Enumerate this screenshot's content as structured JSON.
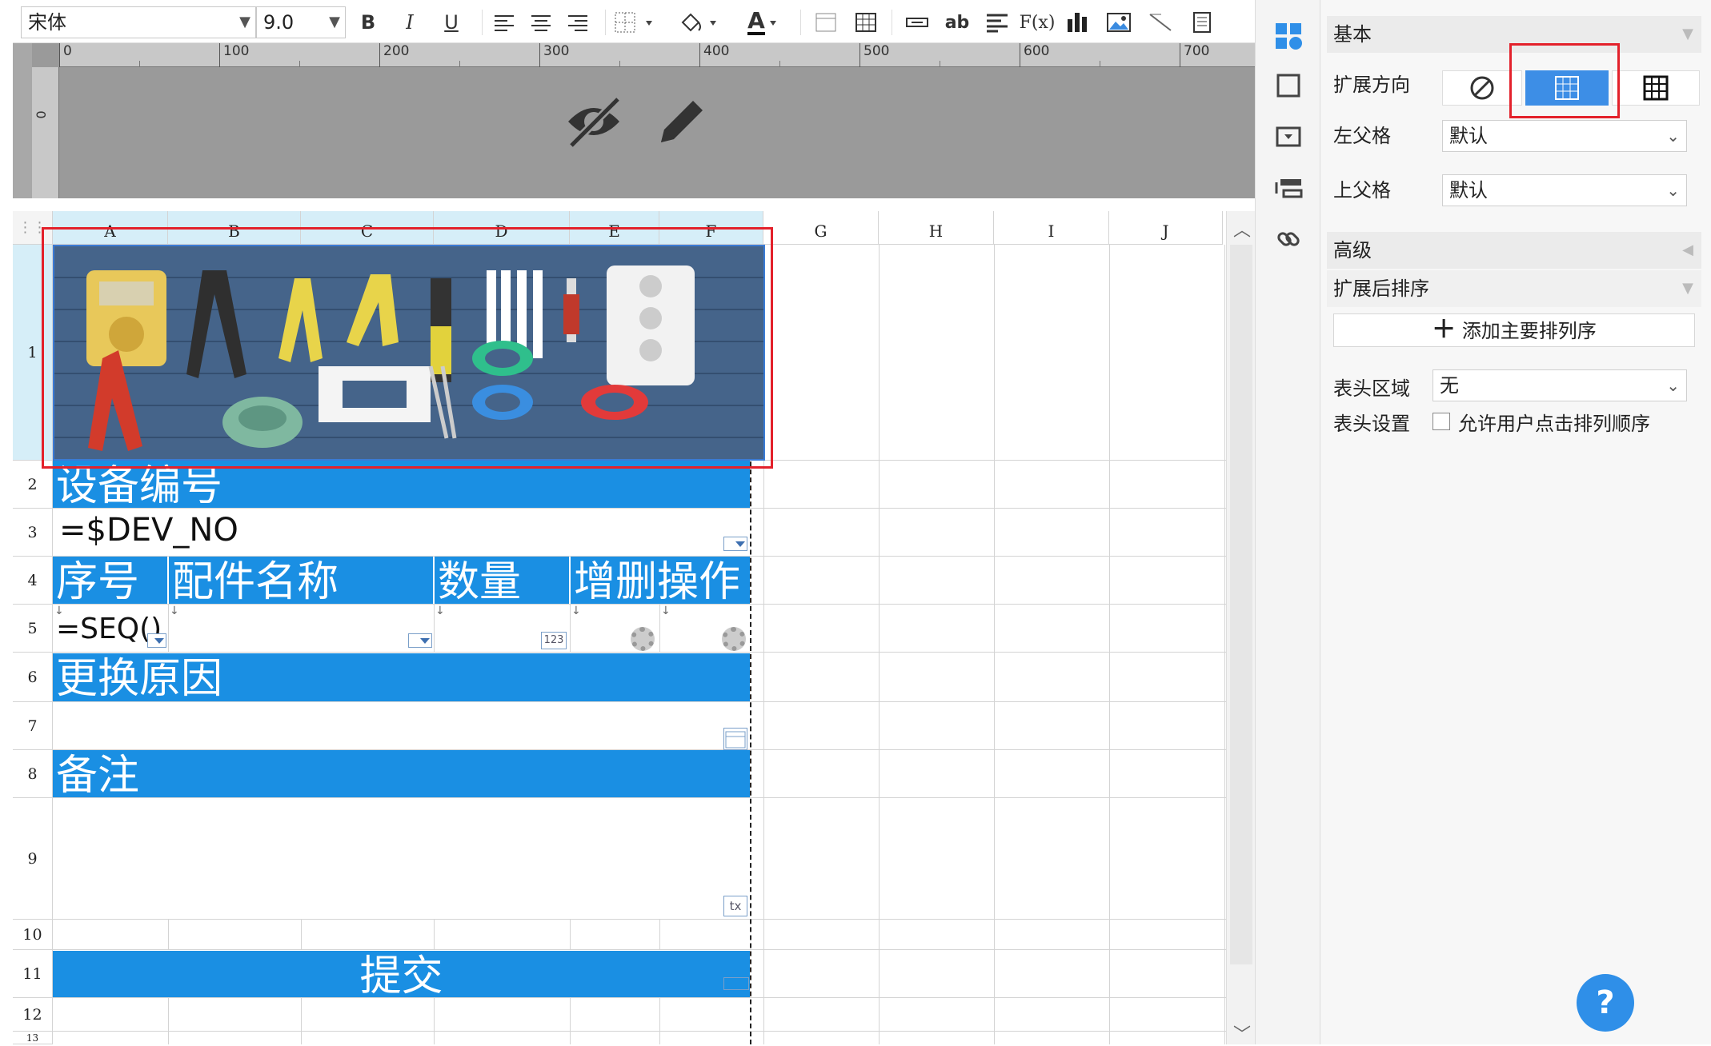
{
  "toolbar": {
    "font_name": "宋体",
    "font_size": "9.0",
    "bold_label": "B",
    "italic_label": "I",
    "underline_label": "U",
    "font_color_label": "A",
    "wrap_label": "ab",
    "formula_label": "F(x)"
  },
  "ruler": {
    "ticks": [
      "0",
      "100",
      "200",
      "300",
      "400",
      "500",
      "600",
      "700"
    ],
    "vertical_label": "0"
  },
  "sheet": {
    "columns": [
      "A",
      "B",
      "C",
      "D",
      "E",
      "F",
      "G",
      "H",
      "I",
      "J"
    ],
    "rows": [
      "1",
      "2",
      "3",
      "4",
      "5",
      "6",
      "7",
      "8",
      "9",
      "10",
      "11",
      "12",
      "13"
    ],
    "cells": {
      "device_no_header": "设备编号",
      "device_no_formula": "=$DEV_NO",
      "seq_header": "序号",
      "part_name_header": "配件名称",
      "qty_header": "数量",
      "ops_header": "增删操作",
      "seq_formula": "=SEQ()",
      "reason_header": "更换原因",
      "remark_header": "备注",
      "submit_label": "提交",
      "qty_tag": "123",
      "text_tag": "tx"
    }
  },
  "panel": {
    "basic_title": "基本",
    "expand_dir_label": "扩展方向",
    "left_parent_label": "左父格",
    "left_parent_value": "默认",
    "top_parent_label": "上父格",
    "top_parent_value": "默认",
    "advanced_title": "高级",
    "post_sort_title": "扩展后排序",
    "add_sort_label": "添加主要排列序",
    "header_area_label": "表头区域",
    "header_area_value": "无",
    "header_settings_label": "表头设置",
    "allow_sort_label": "允许用户点击排列顺序"
  },
  "help_label": "?",
  "colors": {
    "header_blue": "#1a8fe3",
    "active_segment": "#3d8ee6",
    "highlight_red": "#e3212b",
    "selection_tint": "#d6eef8"
  },
  "icons": {
    "rail": [
      "cell-attr-icon",
      "cell-style-icon",
      "widget-icon",
      "condition-icon",
      "hyperlink-icon"
    ]
  }
}
